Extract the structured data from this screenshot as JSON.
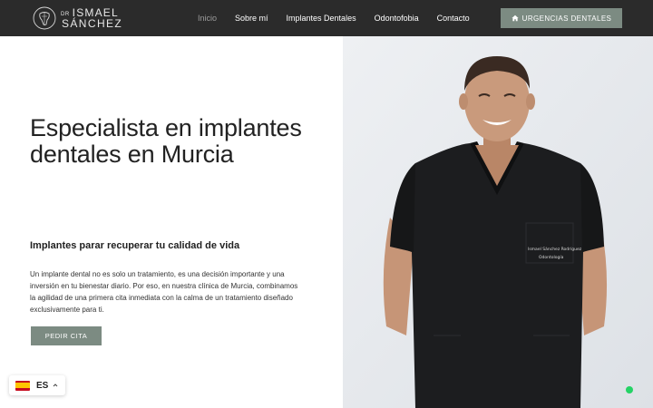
{
  "header": {
    "logo": {
      "prefix": "DR",
      "first_name": "ISMAEL",
      "last_name": "SÁNCHEZ"
    },
    "nav": [
      {
        "label": "Inicio",
        "active": true
      },
      {
        "label": "Sobre mí",
        "active": false
      },
      {
        "label": "Implantes Dentales",
        "active": false
      },
      {
        "label": "Odontofobia",
        "active": false
      },
      {
        "label": "Contacto",
        "active": false
      }
    ],
    "urgent_button": {
      "label": "URGENCIAS DENTALES",
      "icon": "home-icon"
    }
  },
  "hero": {
    "title": "Especialista en implantes dentales en Murcia",
    "subtitle": "Implantes parar recuperar tu calidad de vida",
    "body": "Un implante dental no es solo un tratamiento, es una decisión importante y una inversión en tu bienestar diario. Por eso, en nuestra clínica de Murcia, combinamos la agilidad de una primera cita inmediata con la calma de un tratamiento diseñado exclusivamente para ti.",
    "cta_label": "PEDIR CITA"
  },
  "photo": {
    "scrubs_name": "Ismael Sánchez Rodríguez",
    "scrubs_role": "Odontología"
  },
  "language": {
    "code": "ES",
    "flag": "spain-flag-icon"
  },
  "colors": {
    "header_bg": "#2b2b2b",
    "accent": "#7c8b82",
    "photo_bg": "#e6e9ed",
    "whatsapp": "#25d366"
  }
}
